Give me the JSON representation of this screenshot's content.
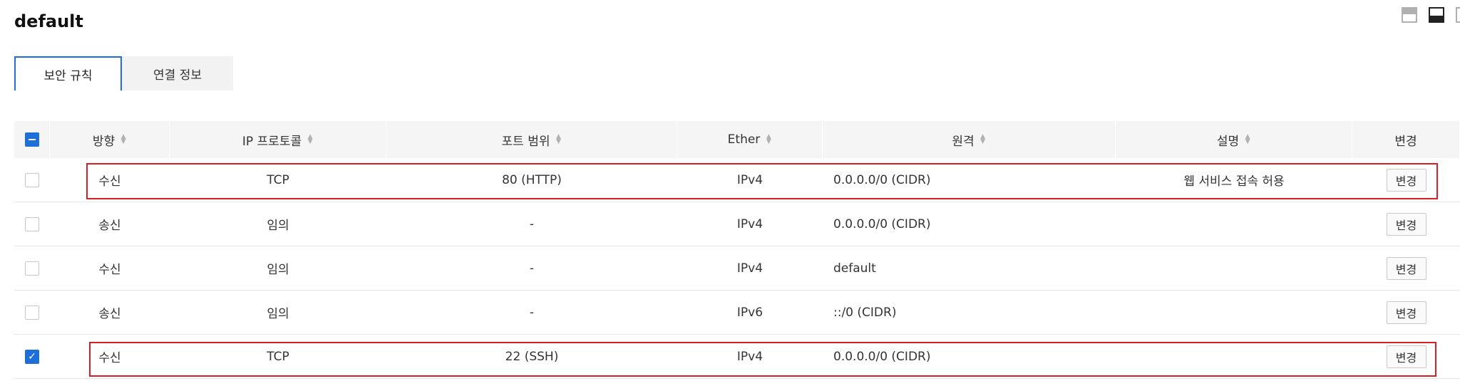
{
  "page": {
    "title": "default"
  },
  "view_icons": [
    "split-view-icon",
    "bottom-panel-icon"
  ],
  "tabs": [
    {
      "label": "보안 규칙",
      "active": true
    },
    {
      "label": "연결 정보",
      "active": false
    }
  ],
  "table": {
    "columns": [
      "방향",
      "IP 프로토콜",
      "포트 범위",
      "Ether",
      "원격",
      "설명",
      "변경"
    ],
    "rows": [
      {
        "direction": "수신",
        "protocol": "TCP",
        "port": "80 (HTTP)",
        "ether": "IPv4",
        "remote": "0.0.0.0/0 (CIDR)",
        "description": "웹 서비스 접속 허용",
        "edit": "변경",
        "checked": false,
        "highlighted": true
      },
      {
        "direction": "송신",
        "protocol": "임의",
        "port": "-",
        "ether": "IPv4",
        "remote": "0.0.0.0/0 (CIDR)",
        "description": "",
        "edit": "변경",
        "checked": false,
        "highlighted": false
      },
      {
        "direction": "수신",
        "protocol": "임의",
        "port": "-",
        "ether": "IPv4",
        "remote": "default",
        "description": "",
        "edit": "변경",
        "checked": false,
        "highlighted": false
      },
      {
        "direction": "송신",
        "protocol": "임의",
        "port": "-",
        "ether": "IPv6",
        "remote": "::/0 (CIDR)",
        "description": "",
        "edit": "변경",
        "checked": false,
        "highlighted": false
      },
      {
        "direction": "수신",
        "protocol": "TCP",
        "port": "22 (SSH)",
        "ether": "IPv4",
        "remote": "0.0.0.0/0 (CIDR)",
        "description": "",
        "edit": "변경",
        "checked": true,
        "highlighted": true
      }
    ]
  },
  "colors": {
    "accent": "#1e6fd9",
    "highlight": "#d81f26",
    "header_bg": "#f5f5f5"
  }
}
